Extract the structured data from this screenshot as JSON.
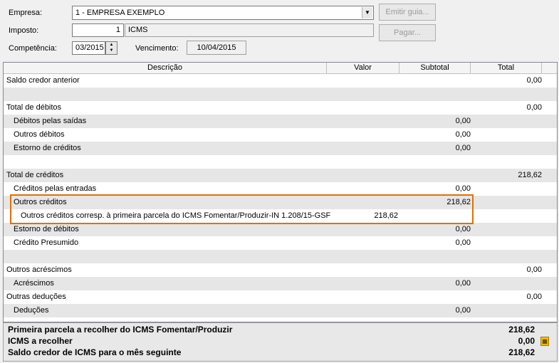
{
  "form": {
    "empresa_label": "Empresa:",
    "empresa_value": "1 - EMPRESA EXEMPLO",
    "imposto_label": "Imposto:",
    "imposto_code": "1",
    "imposto_name": "ICMS",
    "competencia_label": "Competência:",
    "competencia_value": "03/2015",
    "vencimento_label": "Vencimento:",
    "vencimento_value": "10/04/2015",
    "emitir_label": "Emitir guia...",
    "pagar_label": "Pagar..."
  },
  "grid": {
    "headers": [
      "Descrição",
      "Valor",
      "Subtotal",
      "Total"
    ],
    "rows": [
      {
        "desc": "Saldo credor anterior",
        "valor": "",
        "subtotal": "",
        "total": "0,00"
      },
      {
        "desc": "",
        "valor": "",
        "subtotal": "",
        "total": ""
      },
      {
        "desc": "Total de débitos",
        "valor": "",
        "subtotal": "",
        "total": "0,00"
      },
      {
        "desc": "Débitos pelas saídas",
        "valor": "",
        "subtotal": "0,00",
        "total": ""
      },
      {
        "desc": "Outros débitos",
        "valor": "",
        "subtotal": "0,00",
        "total": ""
      },
      {
        "desc": "Estorno de créditos",
        "valor": "",
        "subtotal": "0,00",
        "total": ""
      },
      {
        "desc": "",
        "valor": "",
        "subtotal": "",
        "total": ""
      },
      {
        "desc": "Total de créditos",
        "valor": "",
        "subtotal": "",
        "total": "218,62"
      },
      {
        "desc": "Créditos pelas entradas",
        "valor": "",
        "subtotal": "0,00",
        "total": ""
      },
      {
        "desc": "Outros créditos",
        "valor": "",
        "subtotal": "218,62",
        "total": ""
      },
      {
        "desc": "Outros créditos corresp. à primeira parcela do ICMS Fomentar/Produzir-IN 1.208/15-GSF",
        "valor": "218,62",
        "subtotal": "",
        "total": ""
      },
      {
        "desc": "Estorno de débitos",
        "valor": "",
        "subtotal": "0,00",
        "total": ""
      },
      {
        "desc": "Crédito Presumido",
        "valor": "",
        "subtotal": "0,00",
        "total": ""
      },
      {
        "desc": "",
        "valor": "",
        "subtotal": "",
        "total": ""
      },
      {
        "desc": "Outros acréscimos",
        "valor": "",
        "subtotal": "",
        "total": "0,00"
      },
      {
        "desc": "Acréscimos",
        "valor": "",
        "subtotal": "0,00",
        "total": ""
      },
      {
        "desc": "Outras deduções",
        "valor": "",
        "subtotal": "",
        "total": "0,00"
      },
      {
        "desc": "Deduções",
        "valor": "",
        "subtotal": "0,00",
        "total": ""
      }
    ]
  },
  "footer": {
    "rows": [
      {
        "label": "Primeira parcela a recolher do ICMS Fomentar/Produzir",
        "value": "218,62"
      },
      {
        "label": "ICMS a recolher",
        "value": "0,00"
      },
      {
        "label": "Saldo credor de ICMS para o mês seguinte",
        "value": "218,62"
      }
    ]
  },
  "colors": {
    "highlight": "#e07000",
    "alt_row": "#e6e6e6"
  },
  "icons": {
    "calculator": "calculator-icon"
  }
}
